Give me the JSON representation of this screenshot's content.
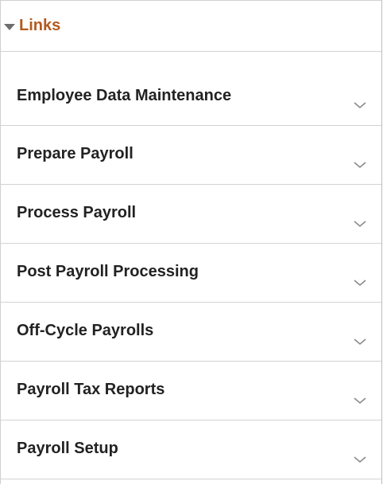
{
  "links_panel": {
    "title": "Links",
    "items": [
      {
        "label": "Employee Data Maintenance"
      },
      {
        "label": "Prepare Payroll"
      },
      {
        "label": "Process Payroll"
      },
      {
        "label": "Post Payroll Processing"
      },
      {
        "label": "Off-Cycle Payrolls"
      },
      {
        "label": "Payroll Tax Reports"
      },
      {
        "label": "Payroll Setup"
      }
    ]
  },
  "colors": {
    "title": "#b35a1f",
    "label": "#222222",
    "divider": "#d3d3d3",
    "chevron": "#8a8a8a"
  },
  "icons": {
    "header_toggle": "collapse-triangle-down-icon",
    "item_expand": "chevron-down-icon"
  }
}
